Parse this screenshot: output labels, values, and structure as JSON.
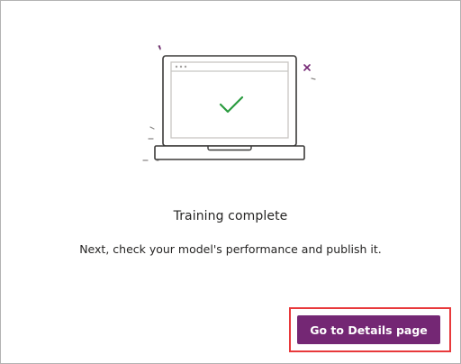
{
  "dialog": {
    "title": "Training complete",
    "message": "Next, check your model's performance and publish it.",
    "primary_button_label": "Go to Details page"
  },
  "illustration": {
    "icon": "laptop-checkmark-icon",
    "check_color": "#2a9b3f",
    "accent_color": "#742774"
  },
  "colors": {
    "button_bg": "#742774",
    "highlight_border": "#e8393b"
  }
}
